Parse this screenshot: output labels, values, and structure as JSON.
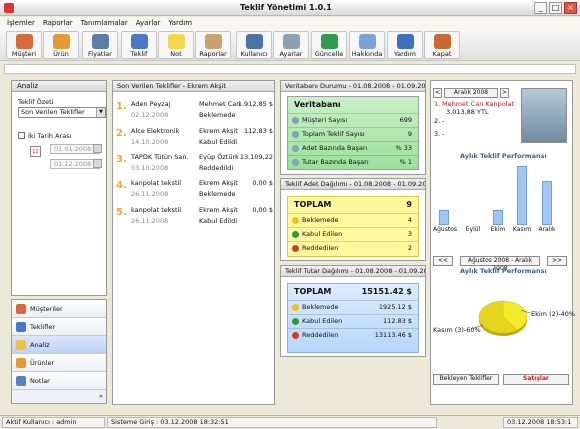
{
  "window": {
    "title": "Teklif Yönetimi 1.0.1"
  },
  "menu": [
    "İşlemler",
    "Raporlar",
    "Tanımlamalar",
    "Ayarlar",
    "Yardım"
  ],
  "toolbar": [
    {
      "label": "Müşteri",
      "icon": "customers-icon",
      "color": "#d66a3a"
    },
    {
      "label": "Ürün",
      "icon": "product-icon",
      "color": "#e39a32"
    },
    {
      "label": "Fiyatlar",
      "icon": "prices-icon",
      "color": "#5c7da8"
    },
    {
      "label": "Teklif",
      "icon": "offer-icon",
      "color": "#4b77c7"
    },
    {
      "label": "Not",
      "icon": "note-icon",
      "color": "#f2d84a"
    },
    {
      "label": "Raporlar",
      "icon": "reports-icon",
      "color": "#c9a36c"
    },
    {
      "label": "Kullanıcı",
      "icon": "user-icon",
      "color": "#4c73a8"
    },
    {
      "label": "Ayarlar",
      "icon": "settings-icon",
      "color": "#8ea0b4"
    },
    {
      "label": "Güncelle",
      "icon": "update-icon",
      "color": "#2f9b4e"
    },
    {
      "label": "Hakkında",
      "icon": "about-icon",
      "color": "#7aa4d8"
    },
    {
      "label": "Yardım",
      "icon": "help-icon",
      "color": "#3e6fbf"
    },
    {
      "label": "Kapat",
      "icon": "exit-icon",
      "color": "#c66a2f"
    }
  ],
  "analysis": {
    "header": "Analiz",
    "offer_summary_label": "Teklif Özeti",
    "offer_summary_value": "Son Verilen Teklifler",
    "date_range_label": "İki Tarih Arası",
    "date_from": "01.01.2008",
    "date_to": "01.12.2008"
  },
  "nav": {
    "items": [
      "Müşteriler",
      "Teklifler",
      "Analiz",
      "Ürünler",
      "Notlar"
    ],
    "active": "Analiz",
    "footer": "»"
  },
  "recent": {
    "header": "Son Verilen Teklifler - Ekrem Akşit",
    "rows": [
      {
        "num": "1.",
        "company": "Aden Peyzaj",
        "date": "02.12.2008",
        "user": "Mehmet Can K",
        "status": "Beklemede",
        "amount": "1.912,85 $"
      },
      {
        "num": "2.",
        "company": "Alce Elektronik",
        "date": "14.10.2008",
        "user": "Ekrem Akşit",
        "status": "Kabul Edildi",
        "amount": "112,83 $"
      },
      {
        "num": "3.",
        "company": "TAPDK Tütün San.",
        "date": "03.10.2008",
        "user": "Eyüp Öztürk",
        "status": "Reddedildi",
        "amount": "13.109,22"
      },
      {
        "num": "4.",
        "company": "kanpolat tekstil",
        "date": "26.11.2008",
        "user": "Ekrem Akşit",
        "status": "Beklemede",
        "amount": "0,00 $"
      },
      {
        "num": "5.",
        "company": "kanpolat tekstil",
        "date": "26.11.2008",
        "user": "Ekrem Akşit",
        "status": "Kabul Edildi",
        "amount": "0,00 $"
      }
    ]
  },
  "db_status": {
    "header": "Veritabanı Durumu - 01.08.2008 - 01.09.2009",
    "title": "Veritabanı",
    "rows": [
      {
        "label": "Müşteri Sayısı",
        "value": "699"
      },
      {
        "label": "Toplam Teklif Sayısı",
        "value": "9"
      },
      {
        "label": "Adet Bazında Başarı",
        "value": "% 33"
      },
      {
        "label": "Tutar Bazında Başarı",
        "value": "% 1"
      }
    ]
  },
  "count_dist": {
    "header": "Teklif Adet Dağılımı - 01.08.2008 - 01.09.2009",
    "title": "TOPLAM",
    "total": "9",
    "rows": [
      {
        "label": "Beklemede",
        "value": "4",
        "color": "#f0c020"
      },
      {
        "label": "Kabul Edilen",
        "value": "3",
        "color": "#2e9a3e"
      },
      {
        "label": "Reddedilen",
        "value": "2",
        "color": "#d63b2a"
      }
    ]
  },
  "amount_dist": {
    "header": "Teklif Tutar Dağılımı - 01.08.2008 - 01.09.2009",
    "title": "TOPLAM",
    "total": "15151.42 $",
    "rows": [
      {
        "label": "Beklemede",
        "value": "1925.12 $",
        "color": "#f0c020"
      },
      {
        "label": "Kabul Edilen",
        "value": "112.83 $",
        "color": "#2e9a3e"
      },
      {
        "label": "Reddedilen",
        "value": "13113.46 $",
        "color": "#d63b2a"
      }
    ]
  },
  "ranking": {
    "prev": "<",
    "month": "Aralık 2008",
    "next": ">",
    "rows": [
      {
        "num": "1.",
        "name": "Mehmet Can Kanpolat",
        "value": "3.013,88 YTL"
      },
      {
        "num": "2.",
        "name": "-",
        "value": ""
      },
      {
        "num": "3.",
        "name": "-",
        "value": ""
      }
    ]
  },
  "chart_data": [
    {
      "type": "bar",
      "title": "Aylık Teklif Performansı",
      "categories": [
        "Ağustos",
        "Eylül",
        "Ekim",
        "Kasım",
        "Aralık"
      ],
      "values": [
        1,
        0,
        1,
        4,
        3
      ],
      "ylim": [
        0,
        4
      ],
      "color": "#9fc7f2"
    },
    {
      "type": "pie",
      "title": "Aylık Teklif Performansı",
      "categories": [
        "Ekim (2)",
        "Kasım (3)"
      ],
      "values": [
        40,
        60
      ],
      "labels": [
        "Ekim (2)-40%",
        "Kasım (3)-60%"
      ],
      "colors": [
        "#f6ea2c",
        "#e5d51f"
      ]
    }
  ],
  "perf": {
    "range_prev": "<<",
    "range_text": "Ağustos 2008 - Aralık 2008",
    "range_next": ">>"
  },
  "buttons": {
    "pending": "Bekleyen Teklifler",
    "sales": "Satışlar"
  },
  "status": {
    "user": "Aktif Kullanıcı : admin",
    "login": "Sisteme Giriş : 03.12.2008 18:32:51",
    "now": "03.12.2008 18:53:1"
  }
}
